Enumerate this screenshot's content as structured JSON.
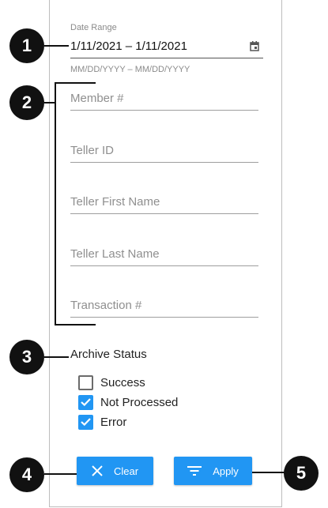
{
  "date_range": {
    "label": "Date Range",
    "value": "1/11/2021 – 1/11/2021",
    "hint": "MM/DD/YYYY – MM/DD/YYYY"
  },
  "fields": [
    {
      "placeholder": "Member #"
    },
    {
      "placeholder": "Teller ID"
    },
    {
      "placeholder": "Teller First Name"
    },
    {
      "placeholder": "Teller Last Name"
    },
    {
      "placeholder": "Transaction #"
    }
  ],
  "archive_status": {
    "title": "Archive Status",
    "options": [
      {
        "label": "Success",
        "checked": false
      },
      {
        "label": "Not Processed",
        "checked": true
      },
      {
        "label": "Error",
        "checked": true
      }
    ]
  },
  "buttons": {
    "clear": "Clear",
    "apply": "Apply"
  },
  "callouts": [
    "1",
    "2",
    "3",
    "4",
    "5"
  ],
  "colors": {
    "accent": "#2196f3",
    "callout": "#111111"
  },
  "icons": {
    "date": "calendar-icon",
    "clear": "close-icon",
    "apply": "filter-icon",
    "checked": "check-icon"
  }
}
